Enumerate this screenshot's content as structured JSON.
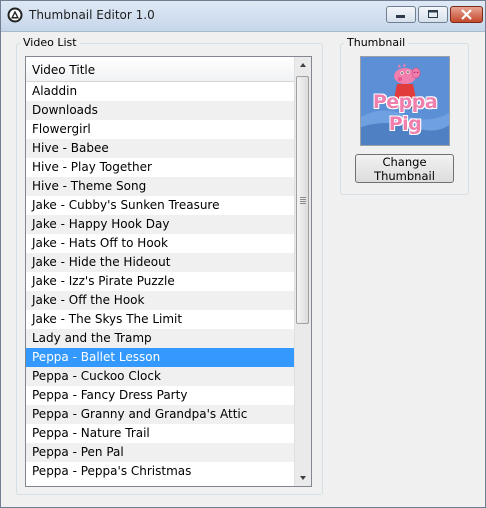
{
  "window": {
    "title": "Thumbnail Editor 1.0"
  },
  "video_list": {
    "group_label": "Video List",
    "column_header": "Video Title",
    "items": [
      "Aladdin",
      "Downloads",
      "Flowergirl",
      "Hive - Babee",
      "Hive - Play Together",
      "Hive - Theme Song",
      "Jake - Cubby's Sunken Treasure",
      "Jake - Happy Hook Day",
      "Jake - Hats Off to Hook",
      "Jake - Hide the Hideout",
      "Jake - Izz's Pirate Puzzle",
      "Jake - Off the Hook",
      "Jake - The Skys The Limit",
      "Lady and the Tramp",
      "Peppa - Ballet Lesson",
      "Peppa - Cuckoo Clock",
      "Peppa - Fancy Dress Party",
      "Peppa - Granny and Grandpa's Attic",
      "Peppa - Nature Trail",
      "Peppa - Pen Pal",
      "Peppa - Peppa's Christmas"
    ],
    "selected_index": 14
  },
  "thumbnail": {
    "group_label": "Thumbnail",
    "image_text": "Peppa Pig",
    "change_button": "Change Thumbnail"
  },
  "colors": {
    "selection": "#3399ff",
    "thumbnail_bg": "#5b8fd6",
    "peppa_pink": "#f07fae",
    "peppa_dress": "#e23b3b"
  },
  "icons": [
    "app-logo-icon",
    "minimize-icon",
    "maximize-icon",
    "close-icon",
    "scroll-up-icon",
    "scroll-down-icon"
  ]
}
